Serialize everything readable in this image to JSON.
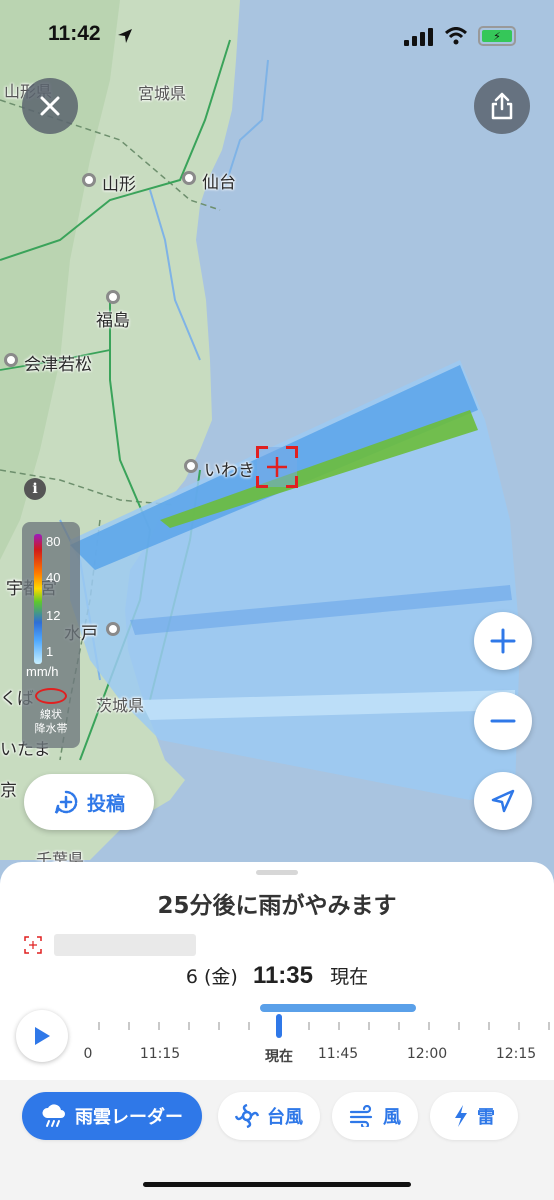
{
  "status_bar": {
    "time": "11:42"
  },
  "map": {
    "labels": [
      {
        "name": "山形県",
        "type": "pref"
      },
      {
        "name": "宮城県",
        "type": "pref"
      },
      {
        "name": "山形",
        "type": "city"
      },
      {
        "name": "仙台",
        "type": "city"
      },
      {
        "name": "福島",
        "type": "city"
      },
      {
        "name": "会津若松",
        "type": "city"
      },
      {
        "name": "いわき",
        "type": "city"
      },
      {
        "name": "宇都宮",
        "type": "city"
      },
      {
        "name": "水戸",
        "type": "city"
      },
      {
        "name": "茨城県",
        "type": "pref"
      },
      {
        "name": "くば",
        "type": "city"
      },
      {
        "name": "いたま",
        "type": "city"
      },
      {
        "name": "京",
        "type": "city"
      },
      {
        "name": "千葉県",
        "type": "pref"
      }
    ]
  },
  "legend": {
    "ticks": [
      "80",
      "40",
      "12",
      "1"
    ],
    "unit": "mm/h",
    "senjo_label_1": "線状",
    "senjo_label_2": "降水帯"
  },
  "post_button": {
    "label": "投稿"
  },
  "sheet": {
    "headline": "25分後に雨がやみます",
    "date_label": "6 (金)",
    "time_label": "11:35",
    "now_label": "現在",
    "timeline_labels": [
      "0",
      "11:15",
      "現在",
      "11:45",
      "12:00",
      "12:15"
    ]
  },
  "tabs": [
    {
      "label": "雨雲レーダー",
      "icon": "rain-cloud-icon",
      "active": true
    },
    {
      "label": "台風",
      "icon": "typhoon-icon",
      "active": false
    },
    {
      "label": "風",
      "icon": "wind-icon",
      "active": false
    },
    {
      "label": "雷",
      "icon": "lightning-icon",
      "active": false
    }
  ],
  "colors": {
    "accent": "#2f78e8",
    "sea": "#a9c4e0",
    "land": "#c9dfc0",
    "rain_light": "#9ccaf2",
    "rain_medium": "#5aa4ea",
    "rain_heavy": "#6cbc3c"
  }
}
